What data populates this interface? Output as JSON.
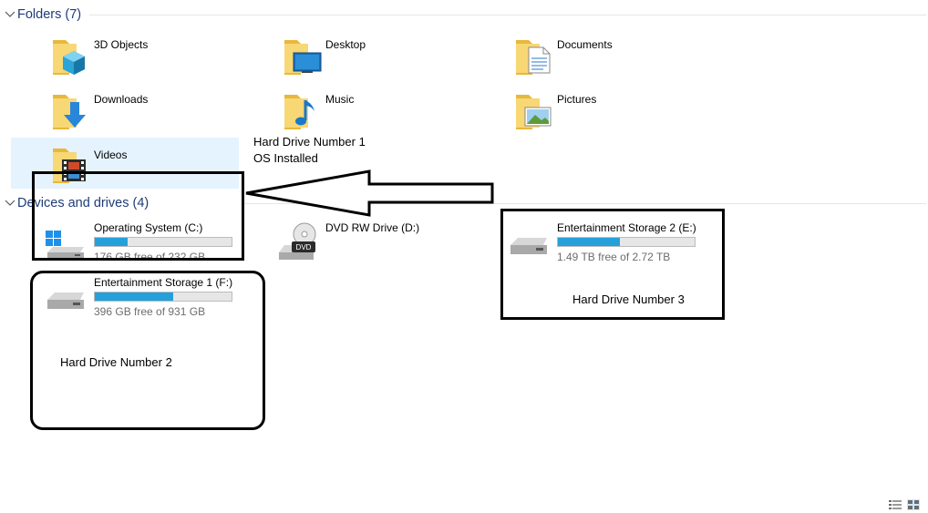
{
  "folders_section": {
    "title": "Folders (7)"
  },
  "folders": [
    {
      "label": "3D Objects",
      "icon": "3d-objects-folder-icon"
    },
    {
      "label": "Desktop",
      "icon": "desktop-folder-icon"
    },
    {
      "label": "Documents",
      "icon": "documents-folder-icon"
    },
    {
      "label": "Downloads",
      "icon": "downloads-folder-icon"
    },
    {
      "label": "Music",
      "icon": "music-folder-icon"
    },
    {
      "label": "Pictures",
      "icon": "pictures-folder-icon"
    },
    {
      "label": "Videos",
      "icon": "videos-folder-icon",
      "selected": true
    }
  ],
  "drives_section": {
    "title": "Devices and drives (4)"
  },
  "drives": [
    {
      "name": "Operating System (C:)",
      "free_text": "176 GB free of 232 GB",
      "used_fraction": 0.24,
      "icon": "windows-drive-icon"
    },
    {
      "name": "DVD RW Drive (D:)",
      "icon": "dvd-drive-icon"
    },
    {
      "name": "Entertainment Storage 2 (E:)",
      "free_text": "1.49 TB free of 2.72 TB",
      "used_fraction": 0.45,
      "icon": "hard-drive-icon"
    },
    {
      "name": "Entertainment Storage 1 (F:)",
      "free_text": "396 GB free of 931 GB",
      "used_fraction": 0.57,
      "icon": "hard-drive-icon"
    }
  ],
  "annotations": {
    "hdd1_line1": "Hard Drive Number 1",
    "hdd1_line2": "OS Installed",
    "hdd2": "Hard Drive Number 2",
    "hdd3": "Hard Drive Number 3"
  },
  "colors": {
    "section_title": "#1e3c78",
    "usage_bar_fill": "#26a0da",
    "selection": "#e5f3ff",
    "folder_yellow": "#f8d775"
  },
  "view_buttons": [
    "details-view-icon",
    "large-icons-view-icon"
  ]
}
